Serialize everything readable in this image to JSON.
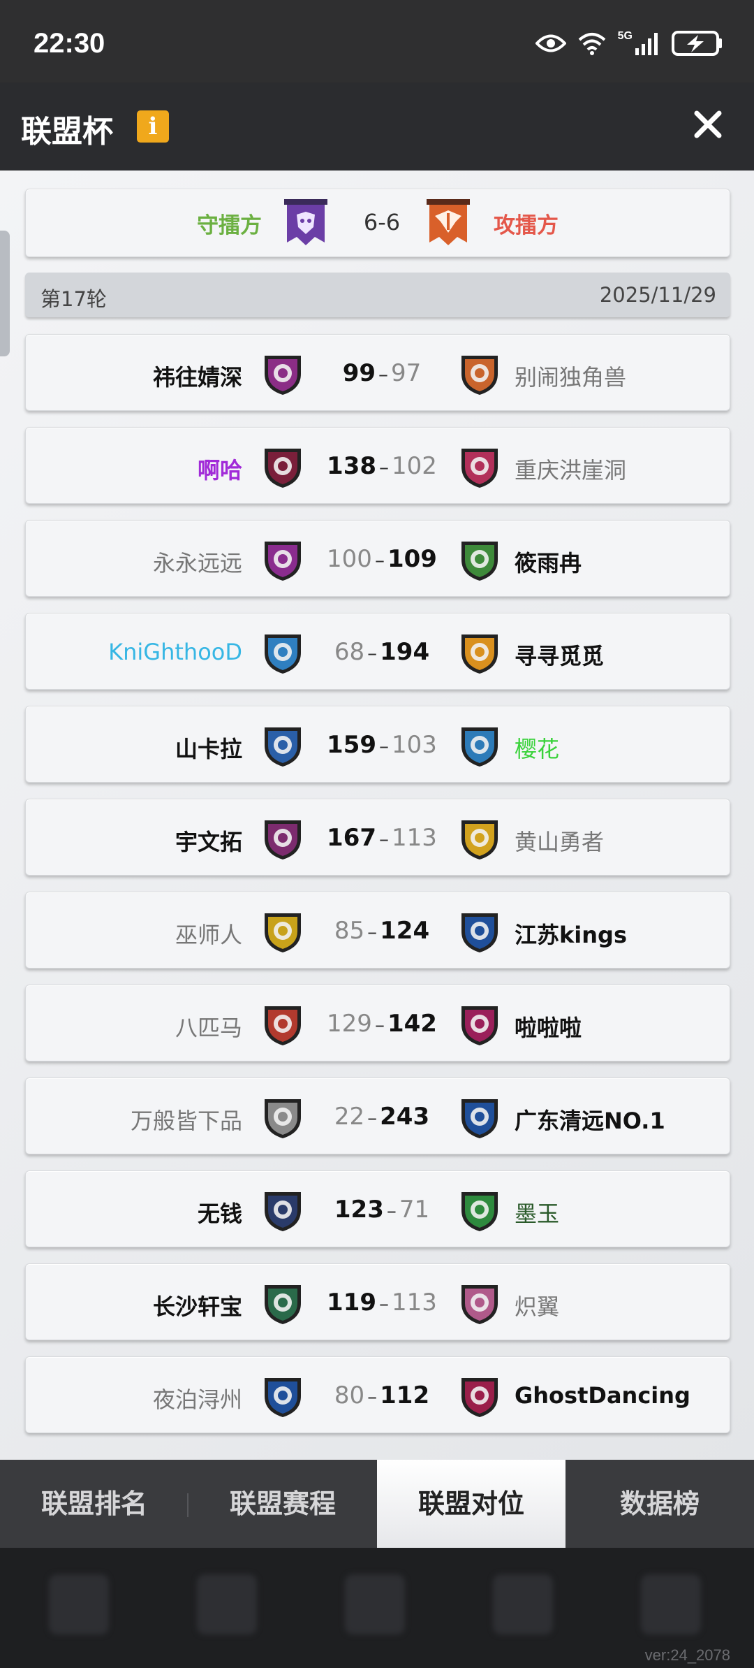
{
  "status_bar": {
    "time": "22:30",
    "network": "5G"
  },
  "header": {
    "title": "联盟杯",
    "info_icon": "i"
  },
  "summary": {
    "left_label": "守擂方",
    "right_label": "攻擂方",
    "score": "6-6"
  },
  "round": {
    "label": "第17轮",
    "date": "2025/11/29"
  },
  "matches": [
    {
      "home": "祎往婧深",
      "home_score": "99",
      "away_score": "97",
      "away": "别闹独角兽",
      "winner": "home",
      "home_color": "#111111",
      "away_color": "#777777",
      "home_logo": "#8b2d86",
      "away_logo": "#c9642c"
    },
    {
      "home": "啊哈",
      "home_score": "138",
      "away_score": "102",
      "away": "重庆洪崖洞",
      "winner": "home",
      "home_color": "#a12ad8",
      "away_color": "#777777",
      "home_logo": "#7a1f3a",
      "away_logo": "#b2305a"
    },
    {
      "home": "永永远远",
      "home_score": "100",
      "away_score": "109",
      "away": "筱雨冉",
      "winner": "away",
      "home_color": "#777777",
      "away_color": "#111111",
      "home_logo": "#8a2c8e",
      "away_logo": "#3e8a3a"
    },
    {
      "home": "KniGhthooD",
      "home_score": "68",
      "away_score": "194",
      "away": "寻寻觅觅",
      "winner": "away",
      "home_color": "#36b6e4",
      "away_color": "#111111",
      "home_logo": "#2f7fc0",
      "away_logo": "#d9901e"
    },
    {
      "home": "山卡拉",
      "home_score": "159",
      "away_score": "103",
      "away": "樱花",
      "winner": "home",
      "home_color": "#111111",
      "away_color": "#39d23a",
      "home_logo": "#2a5fa8",
      "away_logo": "#2d7bb8"
    },
    {
      "home": "宇文拓",
      "home_score": "167",
      "away_score": "113",
      "away": "黄山勇者",
      "winner": "home",
      "home_color": "#111111",
      "away_color": "#777777",
      "home_logo": "#7c2b6e",
      "away_logo": "#d2a21e"
    },
    {
      "home": "巫师人",
      "home_score": "85",
      "away_score": "124",
      "away": "江苏kings",
      "winner": "away",
      "home_color": "#777777",
      "away_color": "#111111",
      "home_logo": "#c8a21a",
      "away_logo": "#1f4f9a"
    },
    {
      "home": "八匹马",
      "home_score": "129",
      "away_score": "142",
      "away": "啦啦啦",
      "winner": "away",
      "home_color": "#777777",
      "away_color": "#111111",
      "home_logo": "#b23a2e",
      "away_logo": "#9a1f5a"
    },
    {
      "home": "万般皆下品",
      "home_score": "22",
      "away_score": "243",
      "away": "广东清远NO.1",
      "winner": "away",
      "home_color": "#777777",
      "away_color": "#111111",
      "home_logo": "#8a8a8a",
      "away_logo": "#1f4f9a"
    },
    {
      "home": "无钱",
      "home_score": "123",
      "away_score": "71",
      "away": "墨玉",
      "winner": "home",
      "home_color": "#111111",
      "away_color": "#2a5a2a",
      "home_logo": "#2a3b6a",
      "away_logo": "#2e8a3e"
    },
    {
      "home": "长沙轩宝",
      "home_score": "119",
      "away_score": "113",
      "away": "炽翼",
      "winner": "home",
      "home_color": "#111111",
      "away_color": "#777777",
      "home_logo": "#2a6a4a",
      "away_logo": "#b05a8a"
    },
    {
      "home": "夜泊浔州",
      "home_score": "80",
      "away_score": "112",
      "away": "GhostDancing",
      "winner": "away",
      "home_color": "#777777",
      "away_color": "#111111",
      "home_logo": "#1f4f9a",
      "away_logo": "#9a1f4a"
    }
  ],
  "tabs": [
    {
      "label": "联盟排名",
      "active": false
    },
    {
      "label": "联盟赛程",
      "active": false
    },
    {
      "label": "联盟对位",
      "active": true
    },
    {
      "label": "数据榜",
      "active": false
    }
  ],
  "version": "ver:24_2078",
  "colors": {
    "defender": "#6bb041",
    "attacker": "#e4574a",
    "header_bg": "#2b2c2f"
  }
}
